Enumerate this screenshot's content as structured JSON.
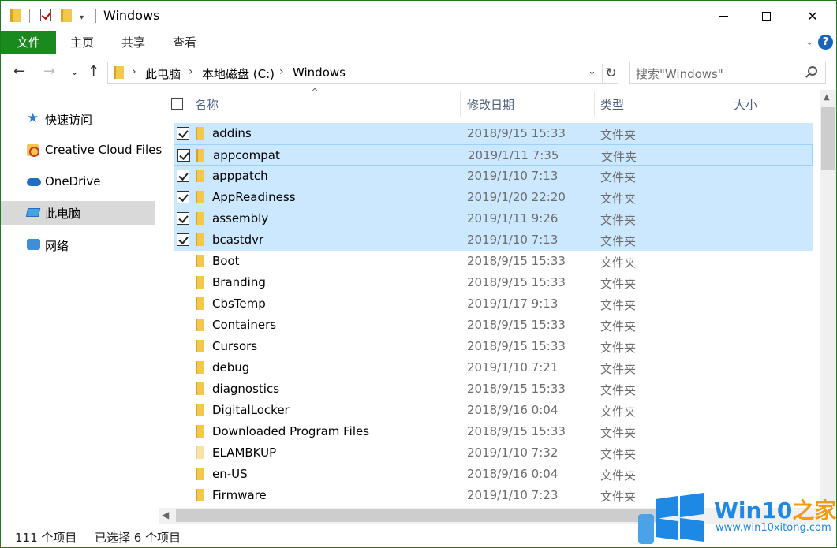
{
  "window": {
    "title": "Windows",
    "quick_access_dropdown": "▾",
    "minimize_glyph": "",
    "close_glyph": "✕"
  },
  "ribbon": {
    "tabs": [
      "文件",
      "主页",
      "共享",
      "查看"
    ],
    "expand_glyph": "⌄",
    "help_glyph": "?"
  },
  "nav": {
    "back_glyph": "←",
    "forward_glyph": "→",
    "recent_glyph": "⌄",
    "up_glyph": "↑"
  },
  "address": {
    "crumbs": [
      "此电脑",
      "本地磁盘 (C:)",
      "Windows"
    ],
    "separator": "›",
    "dropdown_glyph": "⌄",
    "refresh_glyph": "↻"
  },
  "search": {
    "placeholder": "搜索\"Windows\""
  },
  "navpane": {
    "items": [
      {
        "label": "快速访问",
        "icon": "star-icon"
      },
      {
        "label": "Creative Cloud Files",
        "icon": "creative-cloud-icon"
      },
      {
        "label": "OneDrive",
        "icon": "cloud-icon"
      },
      {
        "label": "此电脑",
        "icon": "pc-icon",
        "active": true
      },
      {
        "label": "网络",
        "icon": "network-icon"
      }
    ]
  },
  "columns": {
    "name": "名称",
    "modified": "修改日期",
    "type": "类型",
    "size": "大小",
    "sort_glyph": "^"
  },
  "files": [
    {
      "name": "addins",
      "modified": "2018/9/15 15:33",
      "type": "文件夹",
      "selected": true
    },
    {
      "name": "appcompat",
      "modified": "2019/1/11 7:35",
      "type": "文件夹",
      "selected": true
    },
    {
      "name": "apppatch",
      "modified": "2019/1/10 7:13",
      "type": "文件夹",
      "selected": true
    },
    {
      "name": "AppReadiness",
      "modified": "2019/1/20 22:20",
      "type": "文件夹",
      "selected": true
    },
    {
      "name": "assembly",
      "modified": "2019/1/11 9:26",
      "type": "文件夹",
      "selected": true
    },
    {
      "name": "bcastdvr",
      "modified": "2019/1/10 7:13",
      "type": "文件夹",
      "selected": true
    },
    {
      "name": "Boot",
      "modified": "2018/9/15 15:33",
      "type": "文件夹",
      "selected": false
    },
    {
      "name": "Branding",
      "modified": "2018/9/15 15:33",
      "type": "文件夹",
      "selected": false
    },
    {
      "name": "CbsTemp",
      "modified": "2019/1/17 9:13",
      "type": "文件夹",
      "selected": false
    },
    {
      "name": "Containers",
      "modified": "2018/9/15 15:33",
      "type": "文件夹",
      "selected": false
    },
    {
      "name": "Cursors",
      "modified": "2018/9/15 15:33",
      "type": "文件夹",
      "selected": false
    },
    {
      "name": "debug",
      "modified": "2019/1/10 7:21",
      "type": "文件夹",
      "selected": false
    },
    {
      "name": "diagnostics",
      "modified": "2018/9/15 15:33",
      "type": "文件夹",
      "selected": false
    },
    {
      "name": "DigitalLocker",
      "modified": "2018/9/16 0:04",
      "type": "文件夹",
      "selected": false
    },
    {
      "name": "Downloaded Program Files",
      "modified": "2018/9/15 15:33",
      "type": "文件夹",
      "selected": false
    },
    {
      "name": "ELAMBKUP",
      "modified": "2019/1/10 7:32",
      "type": "文件夹",
      "selected": false
    },
    {
      "name": "en-US",
      "modified": "2018/9/16 0:04",
      "type": "文件夹",
      "selected": false
    },
    {
      "name": "Firmware",
      "modified": "2019/1/10 7:23",
      "type": "文件夹",
      "selected": false
    }
  ],
  "status": {
    "item_count": "111 个项目",
    "selected_count": "已选择 6 个项目"
  },
  "watermark": {
    "brand_main": "Win10",
    "brand_accent": "之家",
    "url": "www.win10xitong.com"
  },
  "colors": {
    "file_tab": "#1a8a1e",
    "selection": "#cce8ff",
    "folder": "#f2c94c",
    "accent": "#1e88e5"
  }
}
